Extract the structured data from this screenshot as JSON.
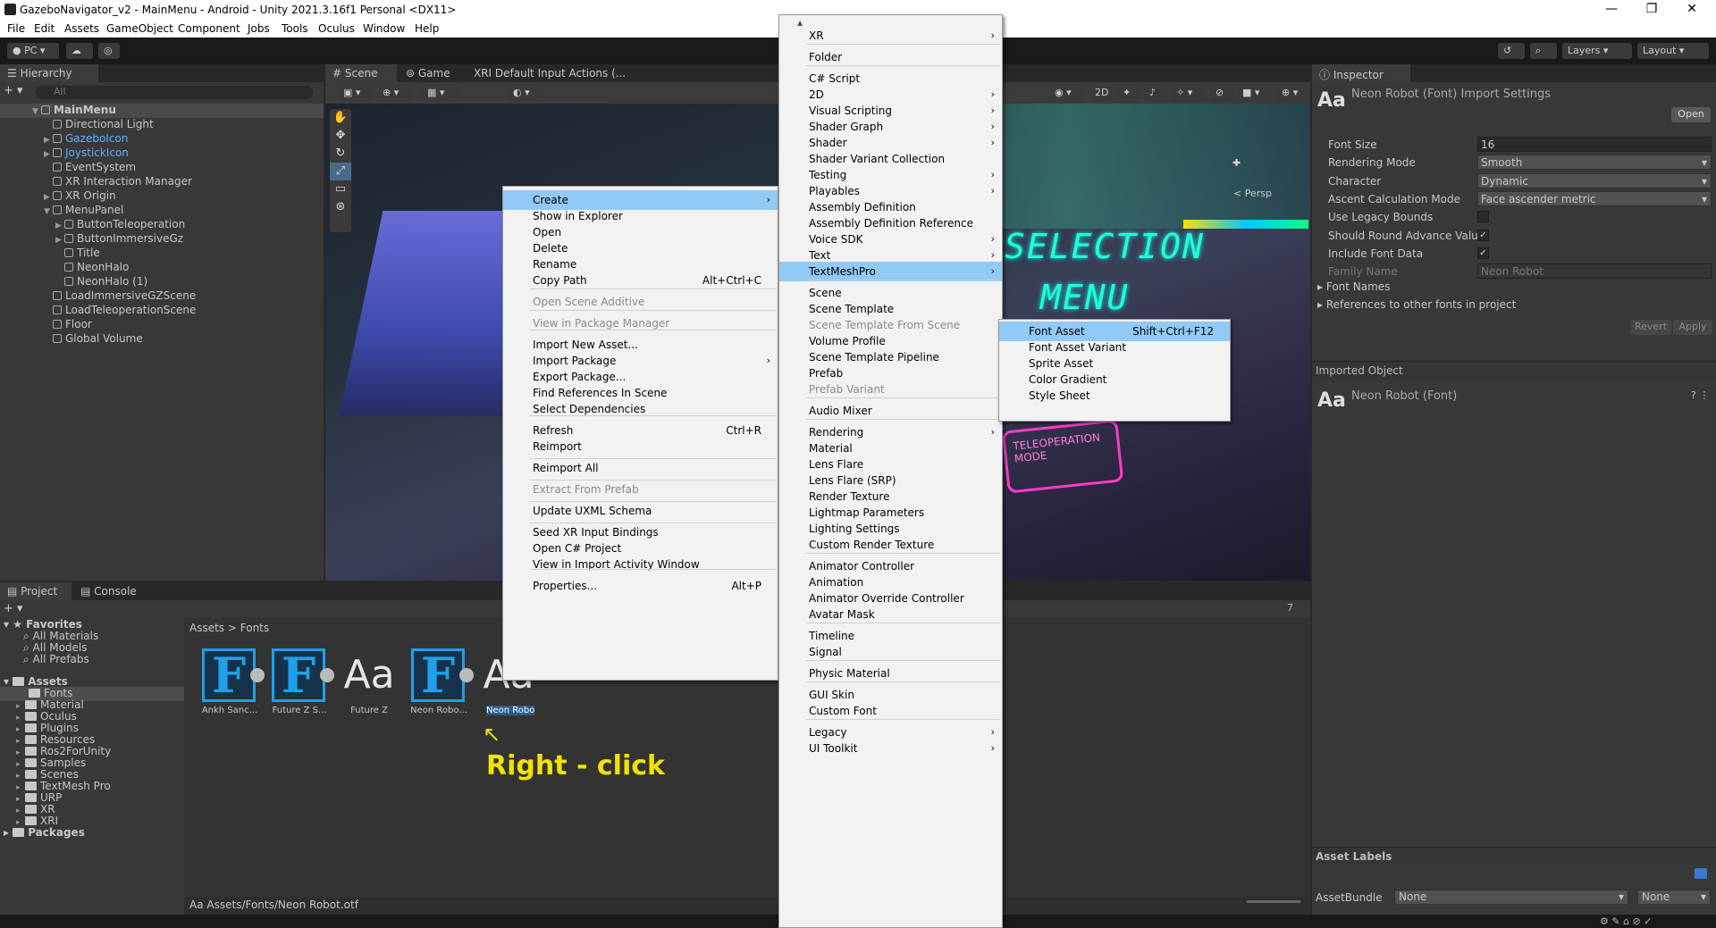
{
  "window": {
    "title": "GazeboNavigator_v2 - MainMenu - Android - Unity 2021.3.16f1 Personal <DX11>",
    "minimize": "—",
    "maximize": "❐",
    "close": "✕"
  },
  "menubar": [
    "File",
    "Edit",
    "Assets",
    "GameObject",
    "Component",
    "Jobs",
    "Tools",
    "Oculus",
    "Window",
    "Help"
  ],
  "toolbar": {
    "platform": "PC",
    "layers": "Layers",
    "layout": "Layout"
  },
  "hierarchy": {
    "tab": "Hierarchy",
    "search_placeholder": "All",
    "items": [
      {
        "label": "MainMenu",
        "depth": 0,
        "expand": "▼",
        "style": "scene"
      },
      {
        "label": "Directional Light",
        "depth": 1,
        "expand": "",
        "style": "normal"
      },
      {
        "label": "GazeboIcon",
        "depth": 1,
        "expand": "▶",
        "style": "prefab"
      },
      {
        "label": "JoystickIcon",
        "depth": 1,
        "expand": "▶",
        "style": "prefab"
      },
      {
        "label": "EventSystem",
        "depth": 1,
        "expand": "",
        "style": "normal"
      },
      {
        "label": "XR Interaction Manager",
        "depth": 1,
        "expand": "",
        "style": "normal"
      },
      {
        "label": "XR Origin",
        "depth": 1,
        "expand": "▶",
        "style": "normal"
      },
      {
        "label": "MenuPanel",
        "depth": 1,
        "expand": "▼",
        "style": "normal"
      },
      {
        "label": "ButtonTeleoperation",
        "depth": 2,
        "expand": "▶",
        "style": "normal"
      },
      {
        "label": "ButtonImmersiveGz",
        "depth": 2,
        "expand": "▶",
        "style": "normal"
      },
      {
        "label": "Title",
        "depth": 2,
        "expand": "",
        "style": "normal"
      },
      {
        "label": "NeonHalo",
        "depth": 2,
        "expand": "",
        "style": "normal"
      },
      {
        "label": "NeonHalo (1)",
        "depth": 2,
        "expand": "",
        "style": "normal"
      },
      {
        "label": "LoadImmersiveGZScene",
        "depth": 1,
        "expand": "",
        "style": "normal"
      },
      {
        "label": "LoadTeleoperationScene",
        "depth": 1,
        "expand": "",
        "style": "normal"
      },
      {
        "label": "Floor",
        "depth": 1,
        "expand": "",
        "style": "normal"
      },
      {
        "label": "Global Volume",
        "depth": 1,
        "expand": "",
        "style": "normal"
      }
    ]
  },
  "scene": {
    "tabs": [
      "Scene",
      "Game",
      "XRI Default Input Actions (..."
    ],
    "persp": "< Persp",
    "btn_2d": "2D",
    "sign1": "SELECTION",
    "sign2": "MENU",
    "sign3": "TELEOPERATION MODE"
  },
  "inspector": {
    "tab": "Inspector",
    "header_icon": "Aa",
    "header_title": "Neon Robot (Font) Import Settings",
    "open": "Open",
    "rows": [
      {
        "label": "Font Size",
        "value": "16",
        "kind": "text"
      },
      {
        "label": "Rendering Mode",
        "value": "Smooth",
        "kind": "dropdown"
      },
      {
        "label": "Character",
        "value": "Dynamic",
        "kind": "dropdown"
      },
      {
        "label": "Ascent Calculation Mode",
        "value": "Face ascender metric",
        "kind": "dropdown"
      },
      {
        "label": "Use Legacy Bounds",
        "value": "",
        "kind": "check"
      },
      {
        "label": "Should Round Advance Value",
        "value": "✓",
        "kind": "check"
      },
      {
        "label": "Include Font Data",
        "value": "✓",
        "kind": "check"
      },
      {
        "label": "Family Name",
        "value": "Neon Robot",
        "kind": "disabled"
      }
    ],
    "font_names": "Font Names",
    "references": "References to other fonts in project",
    "revert": "Revert",
    "apply": "Apply",
    "imported_object": "Imported Object",
    "imported_name": "Neon Robot (Font)",
    "asset_labels": "Asset Labels",
    "asset_bundle": "AssetBundle",
    "bundle_value": "None",
    "variant_value": "None"
  },
  "project": {
    "tabs": [
      "Project",
      "Console"
    ],
    "favorites": "Favorites",
    "fav_items": [
      "All Materials",
      "All Models",
      "All Prefabs"
    ],
    "assets": "Assets",
    "folders": [
      "Fonts",
      "Material",
      "Oculus",
      "Plugins",
      "Resources",
      "Ros2ForUnity",
      "Samples",
      "Scenes",
      "TextMesh Pro",
      "URP",
      "XR",
      "XRI"
    ],
    "packages": "Packages",
    "breadcrumb": [
      "Assets",
      "Fonts"
    ],
    "hidden_count": "7",
    "grid": [
      {
        "label": "Ankh Sanc...",
        "kind": "F"
      },
      {
        "label": "Future Z S...",
        "kind": "F"
      },
      {
        "label": "Future Z",
        "kind": "Aa"
      },
      {
        "label": "Neon Robo...",
        "kind": "F"
      },
      {
        "label": "Neon Robot",
        "kind": "Aa"
      }
    ],
    "status_path": "Assets/Fonts/Neon Robot.otf",
    "annotation": "Right - click"
  },
  "context_menu": {
    "items": [
      {
        "label": "Create",
        "shortcut": "",
        "arrow": "›",
        "state": "selected"
      },
      {
        "label": "Show in Explorer",
        "shortcut": "",
        "arrow": "",
        "state": ""
      },
      {
        "label": "Open",
        "shortcut": "",
        "arrow": "",
        "state": ""
      },
      {
        "label": "Delete",
        "shortcut": "",
        "arrow": "",
        "state": ""
      },
      {
        "label": "Rename",
        "shortcut": "",
        "arrow": "",
        "state": ""
      },
      {
        "label": "Copy Path",
        "shortcut": "Alt+Ctrl+C",
        "arrow": "",
        "state": ""
      },
      {
        "label": "Open Scene Additive",
        "shortcut": "",
        "arrow": "",
        "state": "disabled"
      },
      {
        "label": "View in Package Manager",
        "shortcut": "",
        "arrow": "",
        "state": "disabled"
      },
      {
        "label": "Import New Asset...",
        "shortcut": "",
        "arrow": "",
        "state": ""
      },
      {
        "label": "Import Package",
        "shortcut": "",
        "arrow": "›",
        "state": ""
      },
      {
        "label": "Export Package...",
        "shortcut": "",
        "arrow": "",
        "state": ""
      },
      {
        "label": "Find References In Scene",
        "shortcut": "",
        "arrow": "",
        "state": ""
      },
      {
        "label": "Select Dependencies",
        "shortcut": "",
        "arrow": "",
        "state": ""
      },
      {
        "label": "Refresh",
        "shortcut": "Ctrl+R",
        "arrow": "",
        "state": ""
      },
      {
        "label": "Reimport",
        "shortcut": "",
        "arrow": "",
        "state": ""
      },
      {
        "label": "Reimport All",
        "shortcut": "",
        "arrow": "",
        "state": ""
      },
      {
        "label": "Extract From Prefab",
        "shortcut": "",
        "arrow": "",
        "state": "disabled"
      },
      {
        "label": "Update UXML Schema",
        "shortcut": "",
        "arrow": "",
        "state": ""
      },
      {
        "label": "Seed XR Input Bindings",
        "shortcut": "",
        "arrow": "",
        "state": ""
      },
      {
        "label": "Open C# Project",
        "shortcut": "",
        "arrow": "",
        "state": ""
      },
      {
        "label": "View in Import Activity Window",
        "shortcut": "",
        "arrow": "",
        "state": ""
      },
      {
        "label": "Properties...",
        "shortcut": "Alt+P",
        "arrow": "",
        "state": ""
      }
    ]
  },
  "create_menu": {
    "items": [
      {
        "label": "XR",
        "arrow": "›",
        "state": ""
      },
      {
        "label": "Folder",
        "arrow": "",
        "state": ""
      },
      {
        "label": "C# Script",
        "arrow": "",
        "state": ""
      },
      {
        "label": "2D",
        "arrow": "›",
        "state": ""
      },
      {
        "label": "Visual Scripting",
        "arrow": "›",
        "state": ""
      },
      {
        "label": "Shader Graph",
        "arrow": "›",
        "state": ""
      },
      {
        "label": "Shader",
        "arrow": "›",
        "state": ""
      },
      {
        "label": "Shader Variant Collection",
        "arrow": "",
        "state": ""
      },
      {
        "label": "Testing",
        "arrow": "›",
        "state": ""
      },
      {
        "label": "Playables",
        "arrow": "›",
        "state": ""
      },
      {
        "label": "Assembly Definition",
        "arrow": "",
        "state": ""
      },
      {
        "label": "Assembly Definition Reference",
        "arrow": "",
        "state": ""
      },
      {
        "label": "Voice SDK",
        "arrow": "›",
        "state": ""
      },
      {
        "label": "Text",
        "arrow": "›",
        "state": ""
      },
      {
        "label": "TextMeshPro",
        "arrow": "›",
        "state": "selected"
      },
      {
        "label": "Scene",
        "arrow": "",
        "state": ""
      },
      {
        "label": "Scene Template",
        "arrow": "",
        "state": ""
      },
      {
        "label": "Scene Template From Scene",
        "arrow": "",
        "state": "disabled"
      },
      {
        "label": "Volume Profile",
        "arrow": "",
        "state": ""
      },
      {
        "label": "Scene Template Pipeline",
        "arrow": "",
        "state": ""
      },
      {
        "label": "Prefab",
        "arrow": "",
        "state": ""
      },
      {
        "label": "Prefab Variant",
        "arrow": "",
        "state": "disabled"
      },
      {
        "label": "Audio Mixer",
        "arrow": "",
        "state": ""
      },
      {
        "label": "Rendering",
        "arrow": "›",
        "state": ""
      },
      {
        "label": "Material",
        "arrow": "",
        "state": ""
      },
      {
        "label": "Lens Flare",
        "arrow": "",
        "state": ""
      },
      {
        "label": "Lens Flare (SRP)",
        "arrow": "",
        "state": ""
      },
      {
        "label": "Render Texture",
        "arrow": "",
        "state": ""
      },
      {
        "label": "Lightmap Parameters",
        "arrow": "",
        "state": ""
      },
      {
        "label": "Lighting Settings",
        "arrow": "",
        "state": ""
      },
      {
        "label": "Custom Render Texture",
        "arrow": "",
        "state": ""
      },
      {
        "label": "Animator Controller",
        "arrow": "",
        "state": ""
      },
      {
        "label": "Animation",
        "arrow": "",
        "state": ""
      },
      {
        "label": "Animator Override Controller",
        "arrow": "",
        "state": ""
      },
      {
        "label": "Avatar Mask",
        "arrow": "",
        "state": ""
      },
      {
        "label": "Timeline",
        "arrow": "",
        "state": ""
      },
      {
        "label": "Signal",
        "arrow": "",
        "state": ""
      },
      {
        "label": "Physic Material",
        "arrow": "",
        "state": ""
      },
      {
        "label": "GUI Skin",
        "arrow": "",
        "state": ""
      },
      {
        "label": "Custom Font",
        "arrow": "",
        "state": ""
      },
      {
        "label": "Legacy",
        "arrow": "›",
        "state": ""
      },
      {
        "label": "UI Toolkit",
        "arrow": "›",
        "state": ""
      }
    ]
  },
  "tmp_menu": {
    "items": [
      {
        "label": "Font Asset",
        "shortcut": "Shift+Ctrl+F12",
        "state": "selected"
      },
      {
        "label": "Font Asset Variant",
        "shortcut": "",
        "state": ""
      },
      {
        "label": "Sprite Asset",
        "shortcut": "",
        "state": ""
      },
      {
        "label": "Color Gradient",
        "shortcut": "",
        "state": ""
      },
      {
        "label": "Style Sheet",
        "shortcut": "",
        "state": ""
      }
    ]
  },
  "colors": {
    "accent": "#91c9f7",
    "font_icon": "#1fa0e8",
    "annotation": "#f2e200",
    "prefab_blue": "#5cb3ff"
  }
}
